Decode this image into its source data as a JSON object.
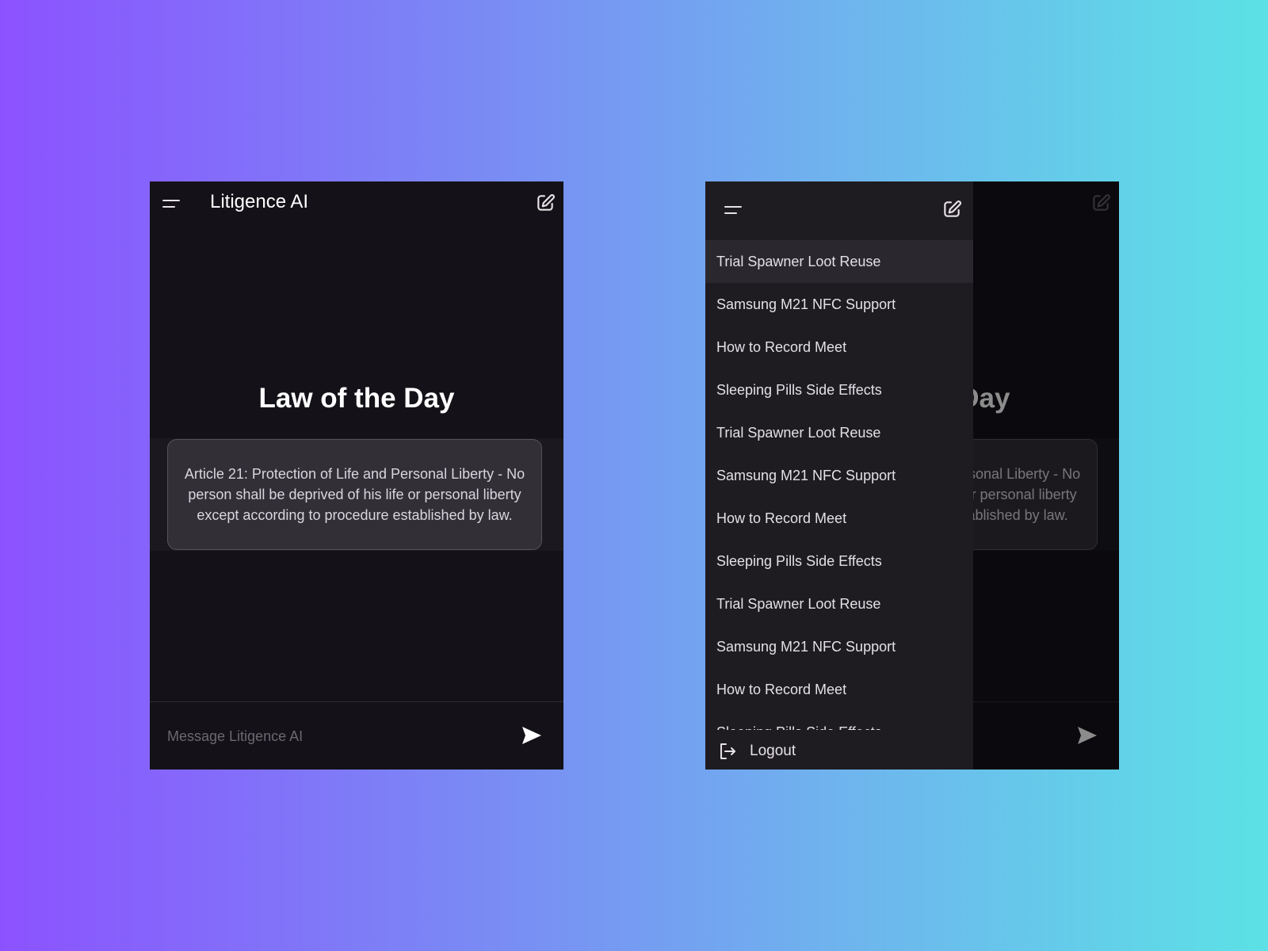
{
  "colors": {
    "background_gradient_start": "#8c52ff",
    "background_gradient_end": "#5ce1e6",
    "surface": "#141218",
    "card": "#322f37",
    "drawer": "#1e1c21"
  },
  "app": {
    "title": "Litigence AI",
    "menu_icon": "menu-icon",
    "new_chat_icon": "edit-icon"
  },
  "main": {
    "heading": "Law of the Day",
    "law_text": "Article 21: Protection of Life and Personal Liberty - No person shall be deprived of his life or personal liberty except according to procedure established by law."
  },
  "composer": {
    "placeholder": "Message Litigence AI",
    "value": "",
    "send_icon": "send-icon"
  },
  "drawer": {
    "history": [
      {
        "label": "Trial Spawner Loot Reuse",
        "active": true
      },
      {
        "label": "Samsung M21 NFC Support"
      },
      {
        "label": "How to Record Meet"
      },
      {
        "label": "Sleeping Pills Side Effects"
      },
      {
        "label": "Trial Spawner Loot Reuse"
      },
      {
        "label": "Samsung M21 NFC Support"
      },
      {
        "label": "How to Record Meet"
      },
      {
        "label": "Sleeping Pills Side Effects"
      },
      {
        "label": "Trial Spawner Loot Reuse"
      },
      {
        "label": "Samsung M21 NFC Support"
      },
      {
        "label": "How to Record Meet"
      },
      {
        "label": "Sleeping Pills Side Effects"
      }
    ],
    "logout_label": "Logout",
    "logout_icon": "logout-icon"
  }
}
